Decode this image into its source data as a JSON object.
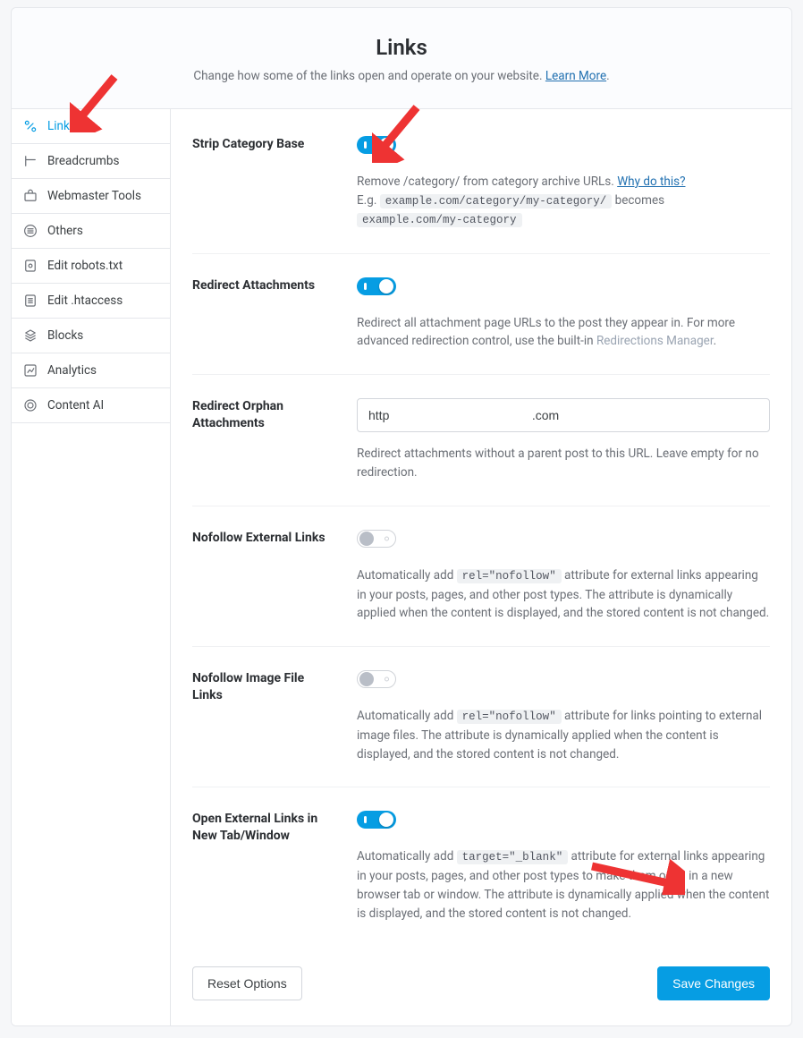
{
  "header": {
    "title": "Links",
    "subtitle_pre": "Change how some of the links open and operate on your website. ",
    "learn_more": "Learn More",
    "subtitle_post": "."
  },
  "sidebar": {
    "items": [
      {
        "label": "Links"
      },
      {
        "label": "Breadcrumbs"
      },
      {
        "label": "Webmaster Tools"
      },
      {
        "label": "Others"
      },
      {
        "label": "Edit robots.txt"
      },
      {
        "label": "Edit .htaccess"
      },
      {
        "label": "Blocks"
      },
      {
        "label": "Analytics"
      },
      {
        "label": "Content AI"
      }
    ]
  },
  "settings": {
    "strip_category_base": {
      "label": "Strip Category Base",
      "enabled": true,
      "desc1_pre": "Remove /category/ from category archive URLs. ",
      "why": "Why do this?",
      "eg_prefix": "E.g. ",
      "code1": "example.com/category/my-category/",
      "becomes": " becomes ",
      "code2": "example.com/my-category"
    },
    "redirect_attachments": {
      "label": "Redirect Attachments",
      "enabled": true,
      "desc_pre": "Redirect all attachment page URLs to the post they appear in. For more advanced redirection control, use the built-in  ",
      "mgr": "Redirections Manager",
      "desc_post": "."
    },
    "redirect_orphan": {
      "label": "Redirect Orphan Attachments",
      "value": "http                                         .com",
      "desc": "Redirect attachments without a parent post to this URL. Leave empty for no redirection."
    },
    "nofollow_external": {
      "label": "Nofollow External Links",
      "enabled": false,
      "desc_pre": "Automatically add ",
      "code": "rel=\"nofollow\"",
      "desc_post": " attribute for external links appearing in your posts, pages, and other post types. The attribute is dynamically applied when the content is displayed, and the stored content is not changed."
    },
    "nofollow_image": {
      "label": "Nofollow Image File Links",
      "enabled": false,
      "desc_pre": "Automatically add ",
      "code": "rel=\"nofollow\"",
      "desc_post": " attribute for links pointing to external image files. The attribute is dynamically applied when the content is displayed, and the stored content is not changed."
    },
    "open_external": {
      "label": "Open External Links in New Tab/Window",
      "enabled": true,
      "desc_pre": "Automatically add ",
      "code": "target=\"_blank\"",
      "desc_post": " attribute for external links appearing in your posts, pages, and other post types to make them open in a new browser tab or window. The attribute is dynamically applied when the content is displayed, and the stored content is not changed."
    }
  },
  "footer": {
    "reset": "Reset Options",
    "save": "Save Changes"
  }
}
